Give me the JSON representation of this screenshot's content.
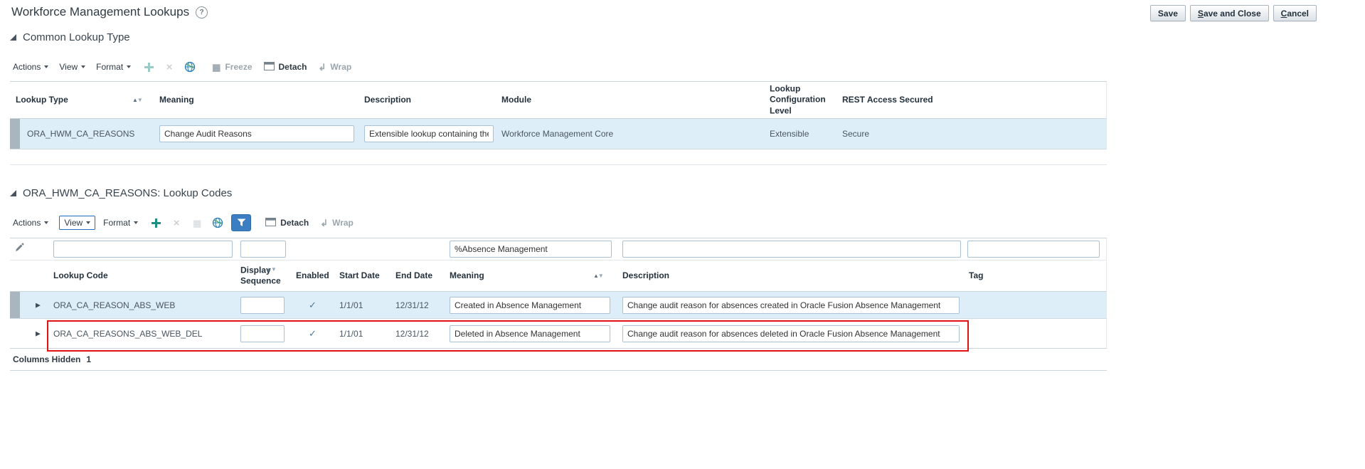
{
  "icons": {
    "help": "?",
    "sort_asc": "▲",
    "sort_desc": "▼",
    "check": "✓",
    "expand_row": "▶",
    "close": "×",
    "freeze_glyph": "▦",
    "grid_glyph": "▦",
    "wrap_glyph": "↲"
  },
  "page": {
    "title": "Workforce Management Lookups"
  },
  "header_actions": {
    "save": "Save",
    "save_and_close": "Save and Close",
    "cancel": "Cancel"
  },
  "section1": {
    "title": "Common Lookup Type",
    "toolbar": {
      "actions": "Actions",
      "view": "View",
      "format": "Format",
      "freeze": "Freeze",
      "detach": "Detach",
      "wrap": "Wrap"
    },
    "columns": {
      "lookup_type": "Lookup Type",
      "meaning": "Meaning",
      "description": "Description",
      "module": "Module",
      "config_level": "Lookup Configuration Level",
      "rest": "REST Access Secured"
    },
    "row": {
      "lookup_type": "ORA_HWM_CA_REASONS",
      "meaning": "Change Audit Reasons",
      "description": "Extensible lookup containing the ch",
      "module": "Workforce Management Core",
      "config_level": "Extensible",
      "rest": "Secure"
    }
  },
  "section2": {
    "title": "ORA_HWM_CA_REASONS: Lookup Codes",
    "toolbar": {
      "actions": "Actions",
      "view": "View",
      "format": "Format",
      "detach": "Detach",
      "wrap": "Wrap"
    },
    "filters": {
      "lookup_code": "",
      "display_sequence": "",
      "meaning": "%Absence Management",
      "description": "",
      "tag": ""
    },
    "columns": {
      "lookup_code": "Lookup Code",
      "display_sequence": "Display Sequence",
      "enabled": "Enabled",
      "start_date": "Start Date",
      "end_date": "End Date",
      "meaning": "Meaning",
      "description": "Description",
      "tag": "Tag"
    },
    "rows": [
      {
        "lookup_code": "ORA_CA_REASON_ABS_WEB",
        "display_sequence": "",
        "enabled": "✓",
        "start_date": "1/1/01",
        "end_date": "12/31/12",
        "meaning": "Created in Absence Management",
        "description": "Change audit reason for absences created in Oracle Fusion Absence Management"
      },
      {
        "lookup_code": "ORA_CA_REASONS_ABS_WEB_DEL",
        "display_sequence": "",
        "enabled": "✓",
        "start_date": "1/1/01",
        "end_date": "12/31/12",
        "meaning": "Deleted in Absence Management",
        "description": "Change audit reason for absences deleted in Oracle Fusion Absence Management"
      }
    ]
  },
  "footer": {
    "columns_hidden_label": "Columns Hidden",
    "columns_hidden_count": "1"
  }
}
